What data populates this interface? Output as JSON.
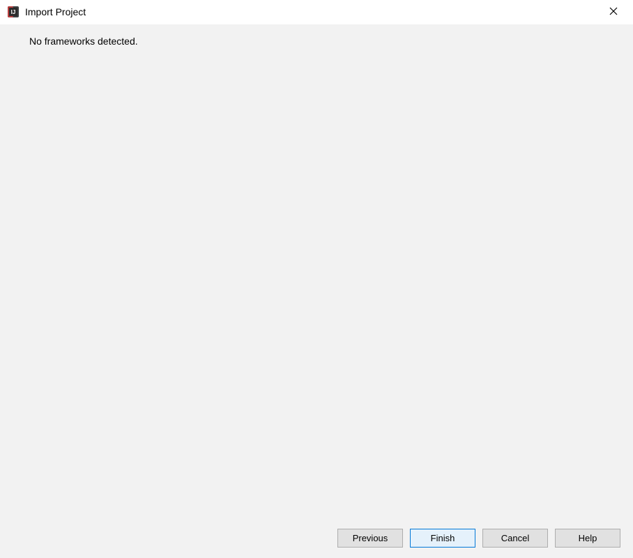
{
  "titlebar": {
    "title": "Import Project"
  },
  "content": {
    "message": "No frameworks detected."
  },
  "buttons": {
    "previous": "Previous",
    "finish": "Finish",
    "cancel": "Cancel",
    "help": "Help"
  }
}
